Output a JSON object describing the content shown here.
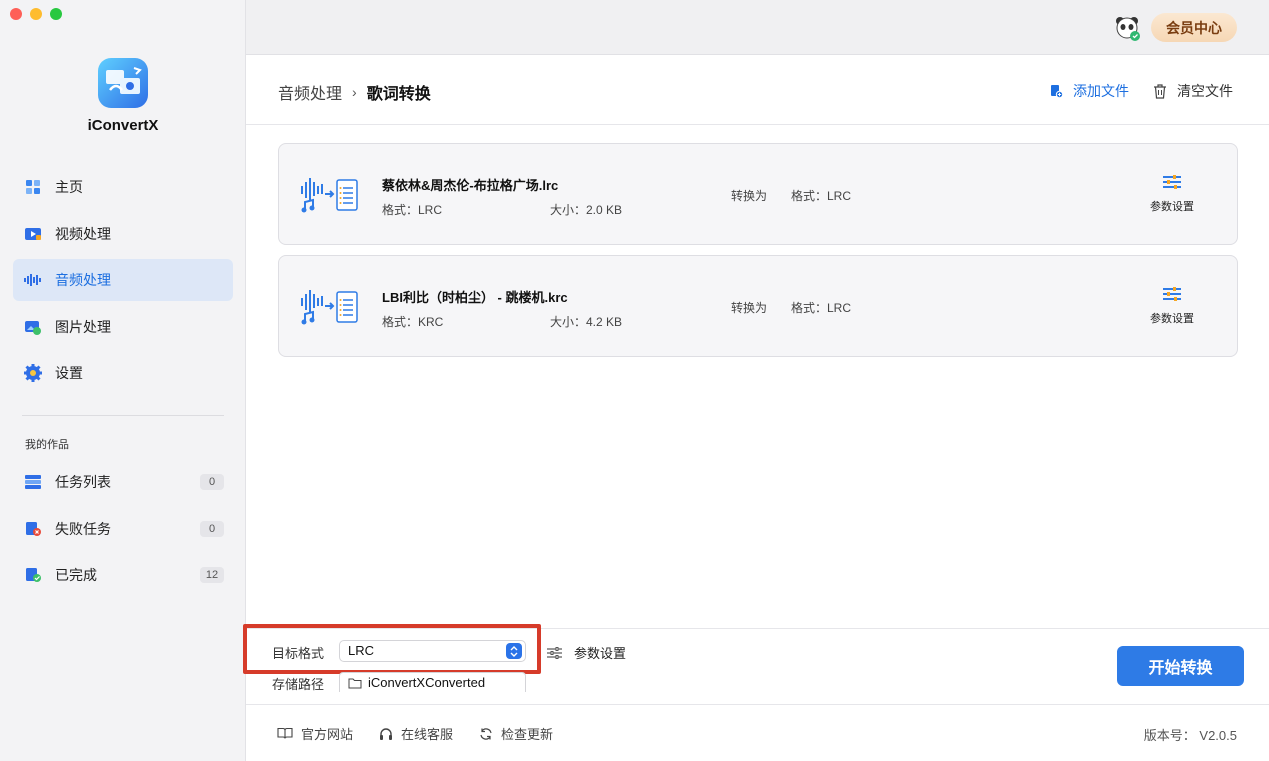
{
  "app": {
    "name": "iConvertX"
  },
  "sidebar": {
    "items": [
      {
        "label": "主页",
        "icon": "home-icon",
        "active": false
      },
      {
        "label": "视频处理",
        "icon": "video-icon",
        "active": false
      },
      {
        "label": "音频处理",
        "icon": "audio-icon",
        "active": true
      },
      {
        "label": "图片处理",
        "icon": "image-icon",
        "active": false
      },
      {
        "label": "设置",
        "icon": "gear-icon",
        "active": false
      }
    ],
    "section_label": "我的作品",
    "works": [
      {
        "label": "任务列表",
        "count": "0",
        "icon": "task-list-icon"
      },
      {
        "label": "失败任务",
        "count": "0",
        "icon": "failed-task-icon"
      },
      {
        "label": "已完成",
        "count": "12",
        "icon": "completed-icon"
      }
    ]
  },
  "topbar": {
    "vip_label": "会员中心",
    "avatar_icon": "panda-avatar-icon"
  },
  "header": {
    "breadcrumb_parent": "音频处理",
    "breadcrumb_sep": "›",
    "breadcrumb_current": "歌词转换",
    "add_file": "添加文件",
    "clear_file": "清空文件"
  },
  "files": [
    {
      "name": "蔡依林&周杰伦-布拉格广场.lrc",
      "format": "格式：LRC",
      "size": "大小：2.0 KB",
      "convert_to": "转换为",
      "output_format": "格式：LRC",
      "param_label": "参数设置"
    },
    {
      "name": "LBI利比（时柏尘） - 跳楼机.krc",
      "format": "格式：KRC",
      "size": "大小：4.2 KB",
      "convert_to": "转换为",
      "output_format": "格式：LRC",
      "param_label": "参数设置"
    }
  ],
  "bottom": {
    "target_label": "目标格式",
    "target_value": "LRC",
    "param_label": "参数设置",
    "store_label": "存储路径",
    "store_path": "iConvertXConverted",
    "start_button": "开始转换"
  },
  "footer": {
    "website": "官方网站",
    "support": "在线客服",
    "update": "检查更新",
    "version": "版本号： V2.0.5"
  },
  "colors": {
    "accent": "#2e7be6",
    "highlight": "#d63b2a",
    "sidebar_active_bg": "#dde7f7"
  }
}
